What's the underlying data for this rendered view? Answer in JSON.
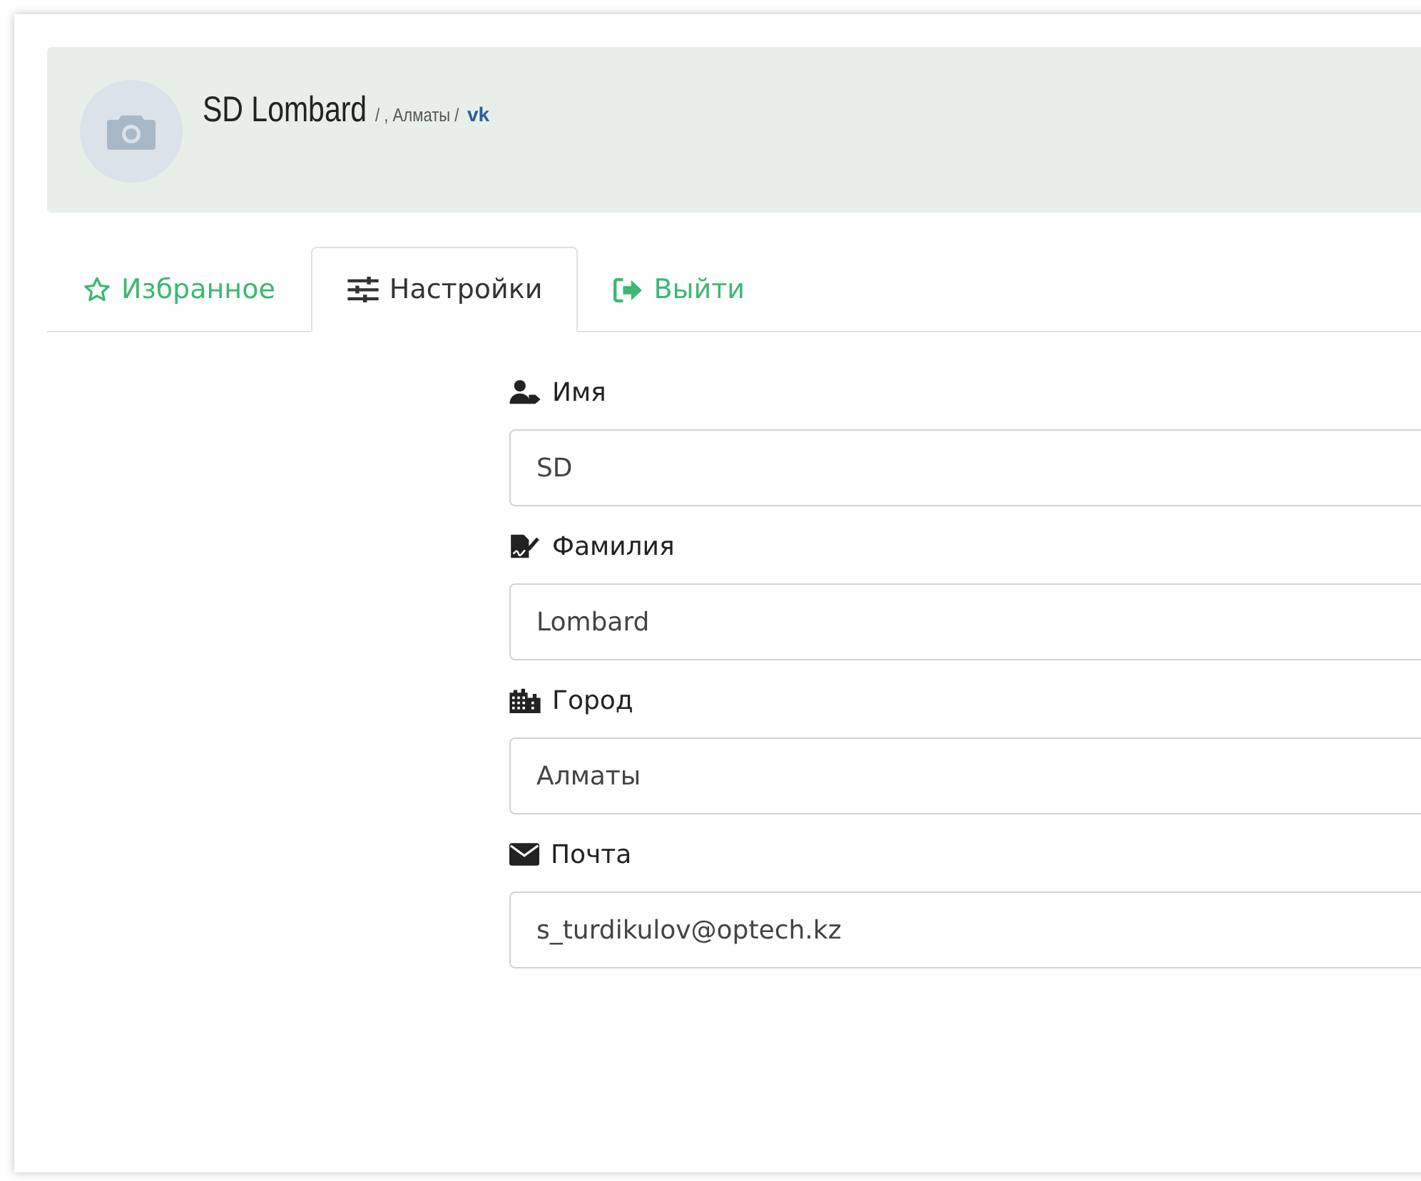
{
  "profile": {
    "name": "SD Lombard",
    "location": "/ , Алматы /",
    "social": "vk"
  },
  "tabs": [
    {
      "label": "Избранное",
      "selected": false
    },
    {
      "label": "Настройки",
      "selected": true
    },
    {
      "label": "Выйти",
      "selected": false
    }
  ],
  "fields": [
    {
      "label": "Имя",
      "value": "SD"
    },
    {
      "label": "Фамилия",
      "value": "Lombard"
    },
    {
      "label": "Город",
      "value": "Алматы"
    },
    {
      "label": "Почта",
      "value": "s_turdikulov@optech.kz"
    }
  ]
}
